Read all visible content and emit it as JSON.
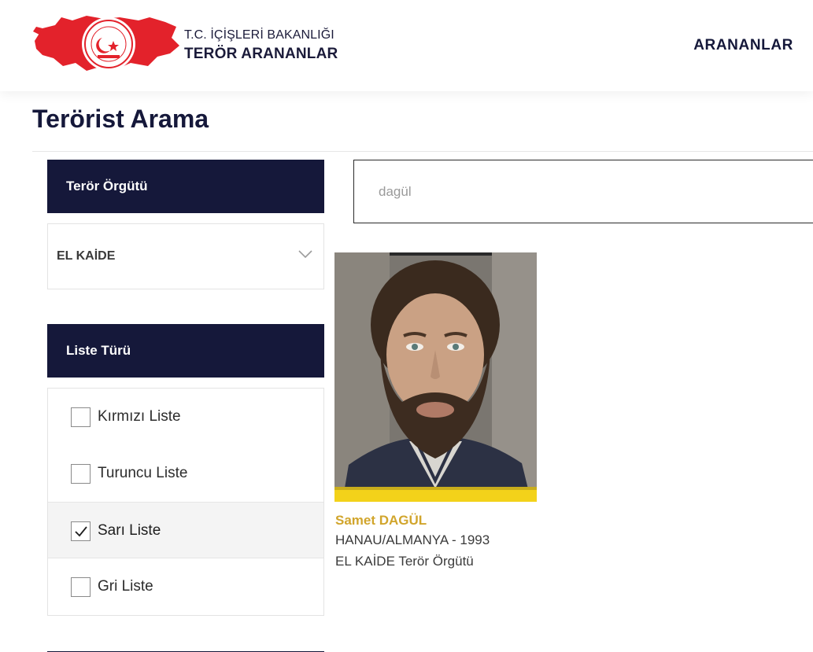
{
  "header": {
    "ministry": "T.C. İÇİŞLERİ BAKANLIĞI",
    "site_title": "TERÖR ARANANLAR",
    "nav": {
      "wanted_label": "ARANANLAR"
    }
  },
  "page": {
    "title": "Terörist Arama"
  },
  "filters": {
    "organization": {
      "heading": "Terör Örgütü",
      "selected": "EL KAİDE"
    },
    "list_type": {
      "heading": "Liste Türü",
      "items": [
        {
          "label": "Kırmızı Liste",
          "checked": false
        },
        {
          "label": "Turuncu Liste",
          "checked": false
        },
        {
          "label": "Sarı Liste",
          "checked": true
        },
        {
          "label": "Gri Liste",
          "checked": false
        }
      ]
    }
  },
  "search": {
    "value": "dagül"
  },
  "results": [
    {
      "name": "Samet DAGÜL",
      "origin": "HANAU/ALMANYA - 1993",
      "organization": "EL KAİDE Terör Örgütü",
      "list_color": "#f3d21a"
    }
  ],
  "colors": {
    "navy": "#15183a",
    "gold": "#d1a52c",
    "logo_red": "#e3222b"
  }
}
